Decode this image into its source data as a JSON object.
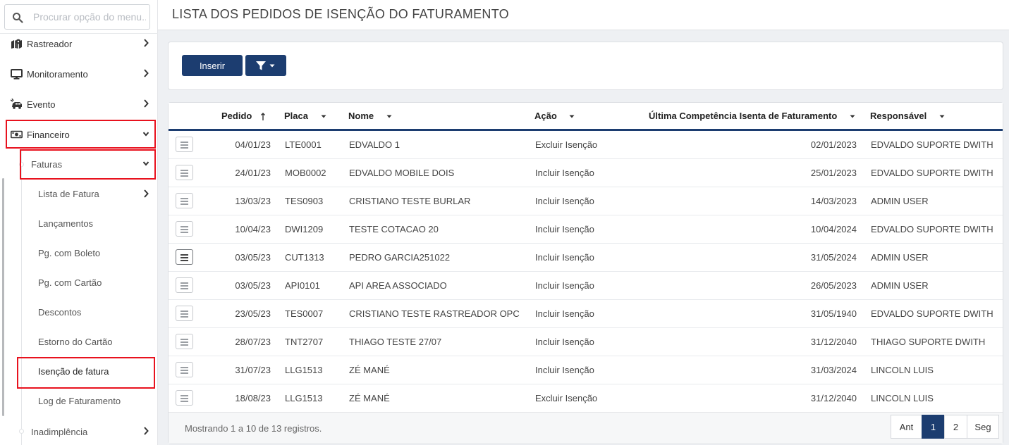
{
  "search": {
    "placeholder": "Procurar opção do menu..."
  },
  "sidebar": {
    "items": [
      {
        "label": "Rastreador",
        "icon": "map-marker-icon"
      },
      {
        "label": "Monitoramento",
        "icon": "monitor-icon"
      },
      {
        "label": "Evento",
        "icon": "car-crash-icon"
      },
      {
        "label": "Financeiro",
        "icon": "money-bill-icon"
      }
    ],
    "faturas_label": "Faturas",
    "sub_items": [
      {
        "label": "Lista de Fatura"
      },
      {
        "label": "Lançamentos"
      },
      {
        "label": "Pg. com Boleto"
      },
      {
        "label": "Pg. com Cartão"
      },
      {
        "label": "Descontos"
      },
      {
        "label": "Estorno do Cartão"
      },
      {
        "label": "Isenção de fatura"
      },
      {
        "label": "Log de Faturamento"
      }
    ],
    "inadimplencia_label": "Inadimplência"
  },
  "header": {
    "title": "LISTA DOS PEDIDOS DE ISENÇÃO DO FATURAMENTO"
  },
  "toolbar": {
    "insert_label": "Inserir",
    "filter_icon": "filter-icon"
  },
  "table": {
    "columns": [
      "Pedido",
      "Placa",
      "Nome",
      "Ação",
      "Última Competência Isenta de Faturamento",
      "Responsável"
    ],
    "rows": [
      [
        "04/01/23",
        "LTE0001",
        "EDVALDO 1",
        "Excluir Isenção",
        "02/01/2023",
        "EDVALDO SUPORTE DWITH"
      ],
      [
        "24/01/23",
        "MOB0002",
        "EDVALDO MOBILE DOIS",
        "Incluir Isenção",
        "25/01/2023",
        "EDVALDO SUPORTE DWITH"
      ],
      [
        "13/03/23",
        "TES0903",
        "CRISTIANO TESTE BURLAR",
        "Incluir Isenção",
        "14/03/2023",
        "ADMIN USER"
      ],
      [
        "10/04/23",
        "DWI1209",
        "TESTE COTACAO 20",
        "Incluir Isenção",
        "10/04/2024",
        "EDVALDO SUPORTE DWITH"
      ],
      [
        "03/05/23",
        "CUT1313",
        "PEDRO GARCIA251022",
        "Incluir Isenção",
        "31/05/2024",
        "ADMIN USER"
      ],
      [
        "03/05/23",
        "API0101",
        "API AREA ASSOCIADO",
        "Incluir Isenção",
        "26/05/2023",
        "ADMIN USER"
      ],
      [
        "23/05/23",
        "TES0007",
        "CRISTIANO TESTE RASTREADOR OPC",
        "Incluir Isenção",
        "31/05/1940",
        "EDVALDO SUPORTE DWITH"
      ],
      [
        "28/07/23",
        "TNT2707",
        "THIAGO TESTE 27/07",
        "Incluir Isenção",
        "31/12/2040",
        "THIAGO SUPORTE DWITH"
      ],
      [
        "31/07/23",
        "LLG1513",
        "ZÉ MANÉ",
        "Incluir Isenção",
        "31/03/2024",
        "LINCOLN LUIS"
      ],
      [
        "18/08/23",
        "LLG1513",
        "ZÉ MANÉ",
        "Excluir Isenção",
        "31/12/2040",
        "LINCOLN LUIS"
      ]
    ]
  },
  "footer": {
    "info": "Mostrando 1 a 10 de 13 registros."
  },
  "pagination": {
    "prev": "Ant",
    "pages": [
      "1",
      "2"
    ],
    "next": "Seg",
    "current": "1"
  },
  "colors": {
    "primary": "#1c3d70",
    "highlight": "#e8121e"
  }
}
